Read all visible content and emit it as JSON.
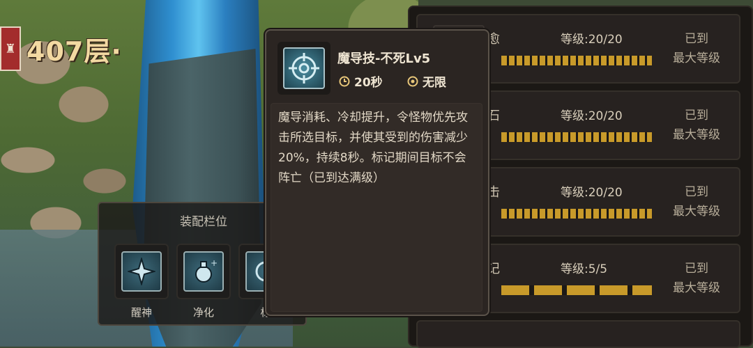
{
  "hud": {
    "floor_label": "407层·"
  },
  "equip_panel": {
    "title": "装配栏位",
    "slots": [
      {
        "label": "醒神",
        "icon": "star-burst-skill-icon"
      },
      {
        "label": "净化",
        "icon": "potion-skill-icon"
      },
      {
        "label": "标",
        "icon": "target-skill-icon"
      }
    ]
  },
  "skill_list": {
    "rows": [
      {
        "name": "愈",
        "level": "等级:20/20",
        "status_line1": "已到",
        "status_line2": "最大等级"
      },
      {
        "name": "石",
        "level": "等级:20/20",
        "status_line1": "已到",
        "status_line2": "最大等级"
      },
      {
        "name": "击",
        "level": "等级:20/20",
        "status_line1": "已到",
        "status_line2": "最大等级"
      },
      {
        "name": "记",
        "level": "等级:5/5",
        "status_line1": "已到",
        "status_line2": "最大等级"
      }
    ]
  },
  "tooltip": {
    "title": "魔导技-不死Lv5",
    "cooldown": "20秒",
    "uses": "无限",
    "description": "魔导消耗、冷却提升，令怪物优先攻击所选目标，并使其受到的伤害减少20%，持续8秒。标记期间目标不会阵亡（已到达满级）",
    "icon": "crosshair-target-icon"
  },
  "colors": {
    "progress_fill": "#c89a2a",
    "panel_bg": "#2b2522",
    "accent_text": "#efe5d2"
  }
}
